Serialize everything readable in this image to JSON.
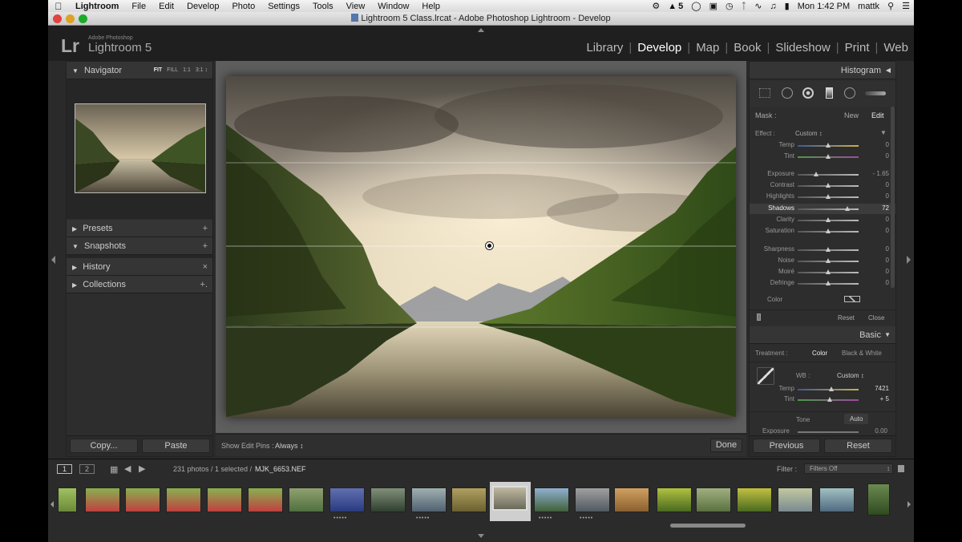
{
  "menubar": {
    "app": "Lightroom",
    "items": [
      "File",
      "Edit",
      "Develop",
      "Photo",
      "Settings",
      "Tools",
      "View",
      "Window",
      "Help"
    ],
    "status_number": "5",
    "clock": "Mon 1:42 PM",
    "user": "mattk"
  },
  "window": {
    "title": "Lightroom 5 Class.lrcat - Adobe Photoshop Lightroom - Develop"
  },
  "brand": {
    "logo": "Lr",
    "line1": "Adobe Photoshop",
    "line2": "Lightroom 5"
  },
  "modules": [
    "Library",
    "Develop",
    "Map",
    "Book",
    "Slideshow",
    "Print",
    "Web"
  ],
  "active_module": "Develop",
  "left_panel": {
    "navigator": {
      "title": "Navigator",
      "zoom": [
        "FIT",
        "FILL",
        "1:1",
        "3:1"
      ]
    },
    "sections": [
      {
        "label": "Presets",
        "action": "+"
      },
      {
        "label": "Snapshots",
        "action": "+"
      },
      {
        "label": "History",
        "action": "×"
      },
      {
        "label": "Collections",
        "action": "+."
      }
    ],
    "copy_label": "Copy...",
    "paste_label": "Paste"
  },
  "right_panel": {
    "histogram_title": "Histogram",
    "mask_label": "Mask :",
    "mask_new": "New",
    "mask_edit": "Edit",
    "effect_label": "Effect :",
    "effect_value": "Custom",
    "sliders": [
      {
        "label": "Temp",
        "value": "0",
        "pos": 0.5
      },
      {
        "label": "Tint",
        "value": "0",
        "pos": 0.5
      },
      {
        "label": "Exposure",
        "value": "- 1.65",
        "pos": 0.3
      },
      {
        "label": "Contrast",
        "value": "0",
        "pos": 0.5
      },
      {
        "label": "Highlights",
        "value": "0",
        "pos": 0.5
      },
      {
        "label": "Shadows",
        "value": "72",
        "pos": 0.82
      },
      {
        "label": "Clarity",
        "value": "0",
        "pos": 0.5
      },
      {
        "label": "Saturation",
        "value": "0",
        "pos": 0.5
      },
      {
        "label": "Sharpness",
        "value": "0",
        "pos": 0.5
      },
      {
        "label": "Noise",
        "value": "0",
        "pos": 0.5
      },
      {
        "label": "Moiré",
        "value": "0",
        "pos": 0.5
      },
      {
        "label": "Defringe",
        "value": "0",
        "pos": 0.5
      }
    ],
    "color_label": "Color",
    "reset_label": "Reset",
    "close_label": "Close",
    "basic_title": "Basic",
    "treatment_label": "Treatment :",
    "treatment_color": "Color",
    "treatment_bw": "Black & White",
    "wb_label": "WB :",
    "wb_value": "Custom",
    "basic_sliders": [
      {
        "label": "Temp",
        "value": "7421",
        "pos": 0.55
      },
      {
        "label": "Tint",
        "value": "+ 5",
        "pos": 0.53
      }
    ],
    "tone_label": "Tone",
    "auto_label": "Auto",
    "exposure_label": "Exposure",
    "exposure_value": "0.00",
    "previous_label": "Previous",
    "reset_button_label": "Reset"
  },
  "toolbar": {
    "show_pins_label": "Show Edit Pins :",
    "show_pins_value": "Always",
    "done_label": "Done"
  },
  "filmstrip": {
    "page1": "1",
    "page2": "2",
    "info": "231 photos / 1 selected /",
    "filename": "MJK_6653.NEF",
    "filter_label": "Filter :",
    "filter_value": "Filters Off"
  }
}
